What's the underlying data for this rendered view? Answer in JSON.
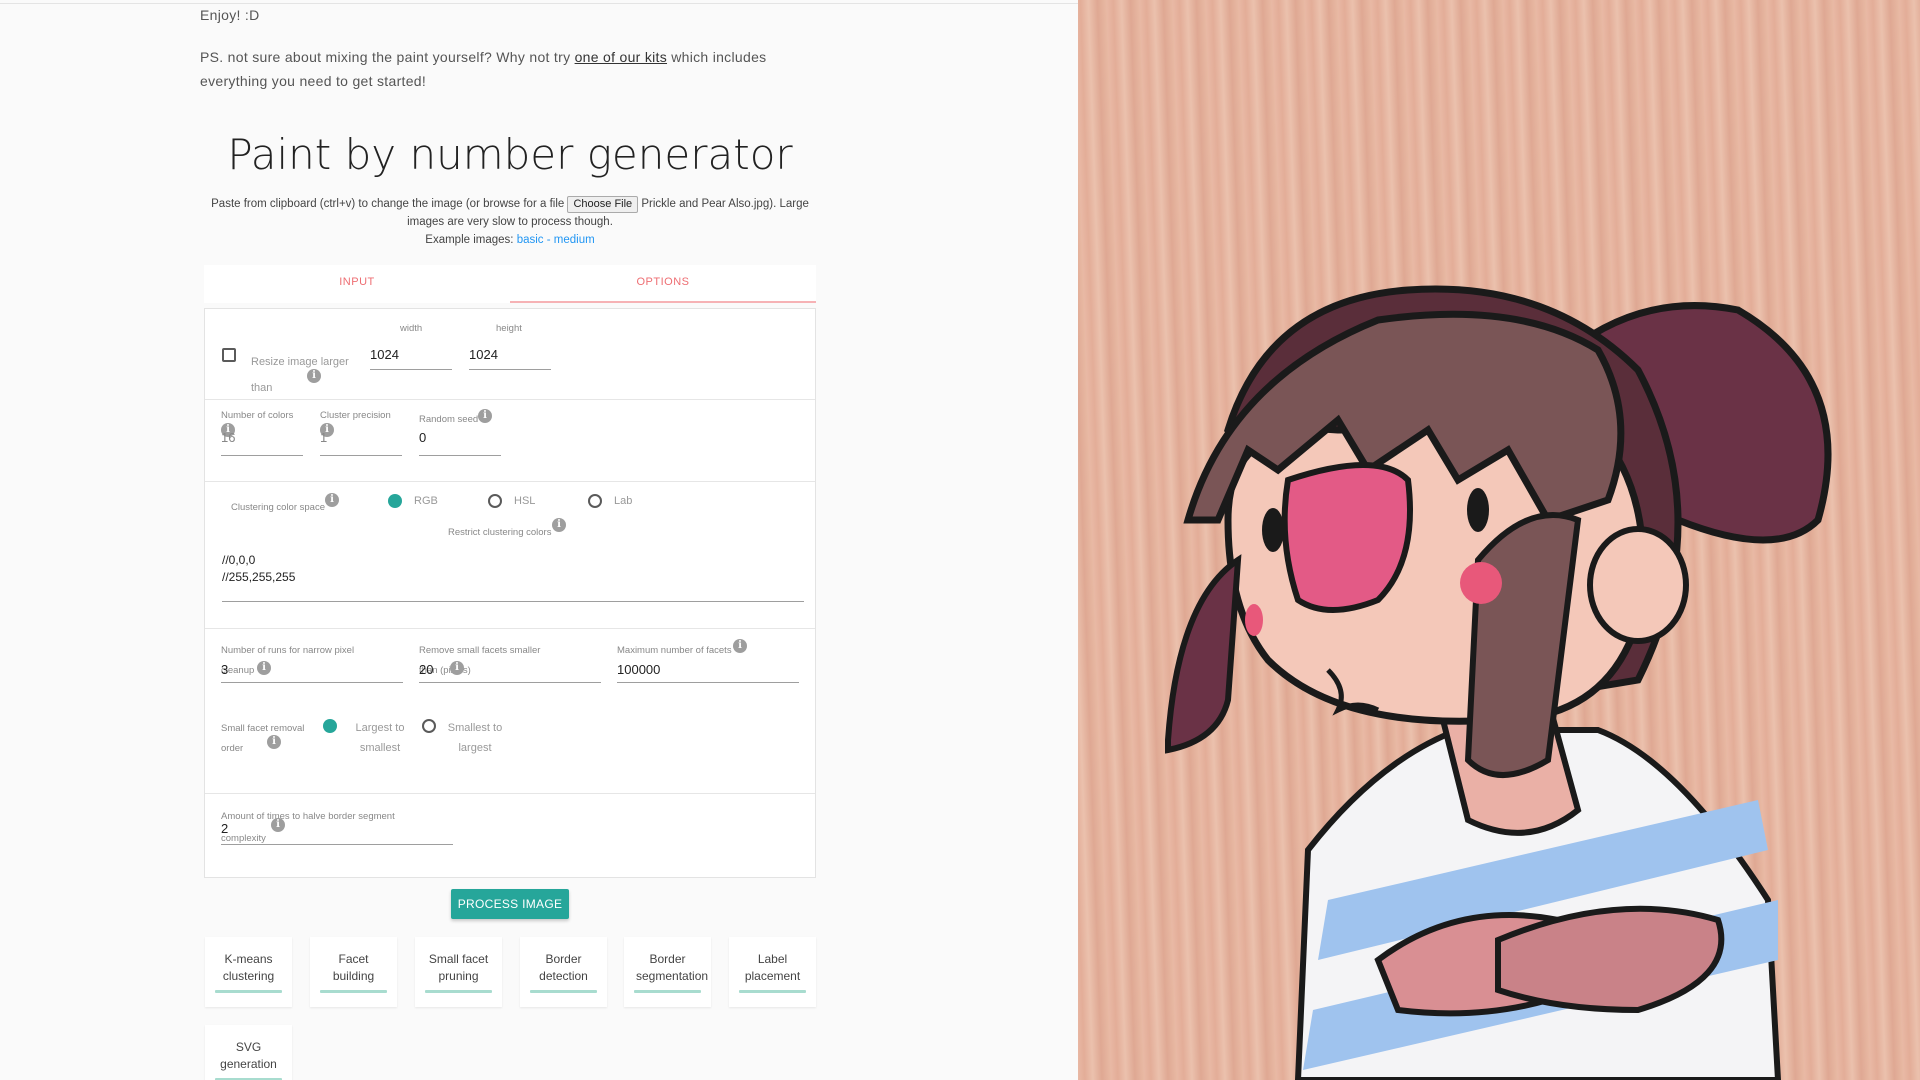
{
  "intro": {
    "enjoy": "Enjoy! :D",
    "ps_text": "PS. not sure about mixing the paint yourself? Why not try ",
    "ps_link": "one of our kits",
    "ps_after": " which includes",
    "ps_line2": "everything you need to get started!"
  },
  "page_title": "Paint by number generator",
  "paste": {
    "before": "Paste from clipboard (ctrl+v) to change the image (or browse for a file ",
    "choose_button": "Choose File",
    "file_name": "Prickle and Pear Also.jpg",
    "after": "). Large images are very slow to process though.",
    "examples_label": "Example images:",
    "example_basic": "basic",
    "example_sep": " - ",
    "example_medium": "medium"
  },
  "tabs": [
    {
      "label": "INPUT",
      "active": false
    },
    {
      "label": "OPTIONS",
      "active": true
    }
  ],
  "options": {
    "resize_label": "Resize image larger than",
    "resize_checked": false,
    "width_label": "width",
    "width_value": "1024",
    "height_label": "height",
    "height_value": "1024",
    "num_colors_label": "Number of colors",
    "num_colors_value": "16",
    "cluster_precision_label": "Cluster precision",
    "cluster_precision_value": "1",
    "random_seed_label": "Random seed",
    "random_seed_value": "0",
    "color_space_label": "Clustering color space",
    "color_space_options": [
      {
        "label": "RGB",
        "selected": true
      },
      {
        "label": "HSL",
        "selected": false
      },
      {
        "label": "Lab",
        "selected": false
      }
    ],
    "restrict_label": "Restrict clustering colors",
    "restrict_lines": [
      "//0,0,0",
      "//255,255,255"
    ],
    "narrow_runs_label": "Number of runs for narrow pixel cleanup",
    "narrow_runs_value": "3",
    "small_facets_label": "Remove small facets smaller than (pixels)",
    "small_facets_value": "20",
    "max_facets_label": "Maximum number of facets",
    "max_facets_value": "100000",
    "removal_order_label": "Small facet removal order",
    "removal_order_options": [
      {
        "label": "Largest to smallest",
        "selected": true
      },
      {
        "label": "Smallest to largest",
        "selected": false
      }
    ],
    "halve_border_label": "Amount of times to halve border segment complexity",
    "halve_border_value": "2"
  },
  "process_button": "PROCESS IMAGE",
  "steps": [
    {
      "label": "K-means clustering",
      "progress": 1.0
    },
    {
      "label": "Facet building",
      "progress": 1.0
    },
    {
      "label": "Small facet pruning",
      "progress": 1.0
    },
    {
      "label": "Border detection",
      "progress": 1.0
    },
    {
      "label": "Border segmentation",
      "progress": 1.0
    },
    {
      "label": "Label placement",
      "progress": 1.0
    },
    {
      "label": "SVG generation",
      "progress": 1.0
    }
  ],
  "colors": {
    "accent_teal": "#26a69a",
    "tab_pink": "#ee6e73",
    "link_blue": "#2196f3",
    "wood": "#e6b29d"
  }
}
